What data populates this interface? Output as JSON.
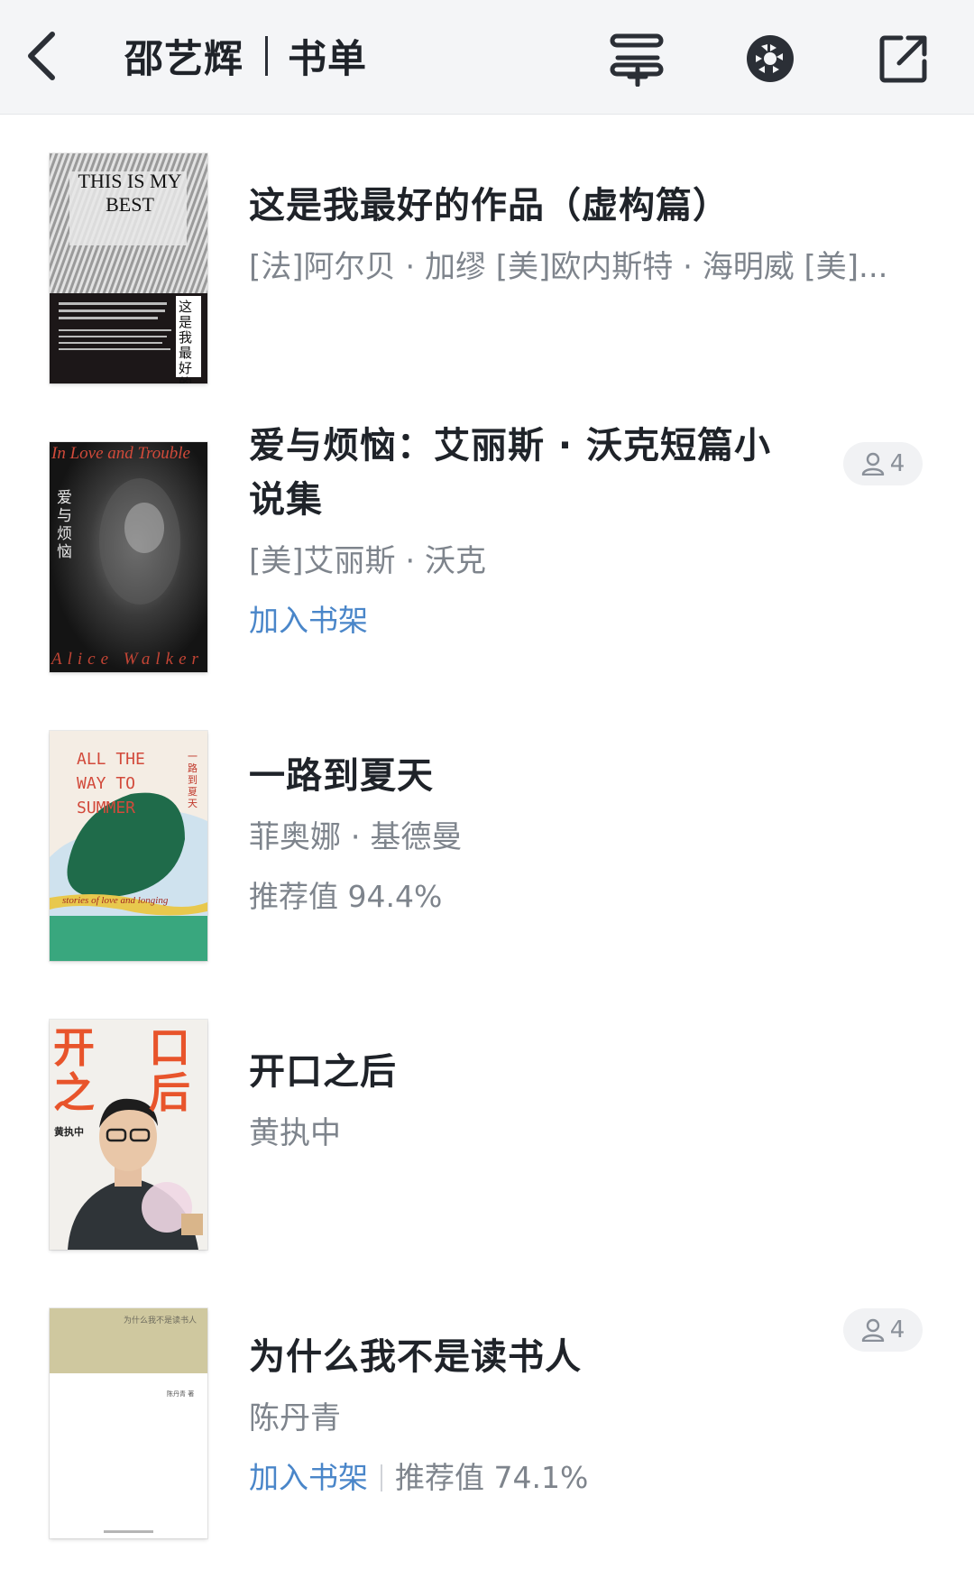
{
  "header": {
    "title_owner": "邵艺辉",
    "title_section": "书单",
    "icons": [
      "back-arrow-icon",
      "add-to-list-icon",
      "aperture-icon",
      "share-external-icon"
    ]
  },
  "books": [
    {
      "title": "这是我最好的作品（虚构篇）",
      "author": "[法]阿尔贝 · 加缪 [美]欧内斯特 · 海明威 [美]...",
      "cover_title": "THIS IS MY BEST",
      "cover_side_text": "这是我最好的作品"
    },
    {
      "title": "爱与烦恼：艾丽斯 · 沃克短篇小说集",
      "author": "[美]艾丽斯 · 沃克",
      "action": "加入书架",
      "readers": "4",
      "cover_top_text": "In Love and Trouble",
      "cover_side_text": "爱与烦恼",
      "cover_bottom_text": "Alice Walker"
    },
    {
      "title": "一路到夏天",
      "author": "菲奥娜 · 基德曼",
      "rating": "推荐值 94.4%",
      "cover_title": "ALL THE WAY TO SUMMER",
      "cover_subtitle": "stories of love and longing",
      "cover_side_text": "一路到夏天"
    },
    {
      "title": "开口之后",
      "author": "黄执中",
      "cover_title_left": "开之",
      "cover_title_right": "口后",
      "cover_author": "黄执中"
    },
    {
      "title": "为什么我不是读书人",
      "author": "陈丹青",
      "action": "加入书架",
      "rating": "推荐值 74.1%",
      "readers": "4",
      "cover_title": "为什么我不是读书人",
      "cover_author": "陈丹青 著"
    }
  ],
  "colors": {
    "header_bg": "#f4f5f7",
    "title_text": "#1f2329",
    "secondary_text": "#7e848c",
    "link": "#4a86c9"
  }
}
